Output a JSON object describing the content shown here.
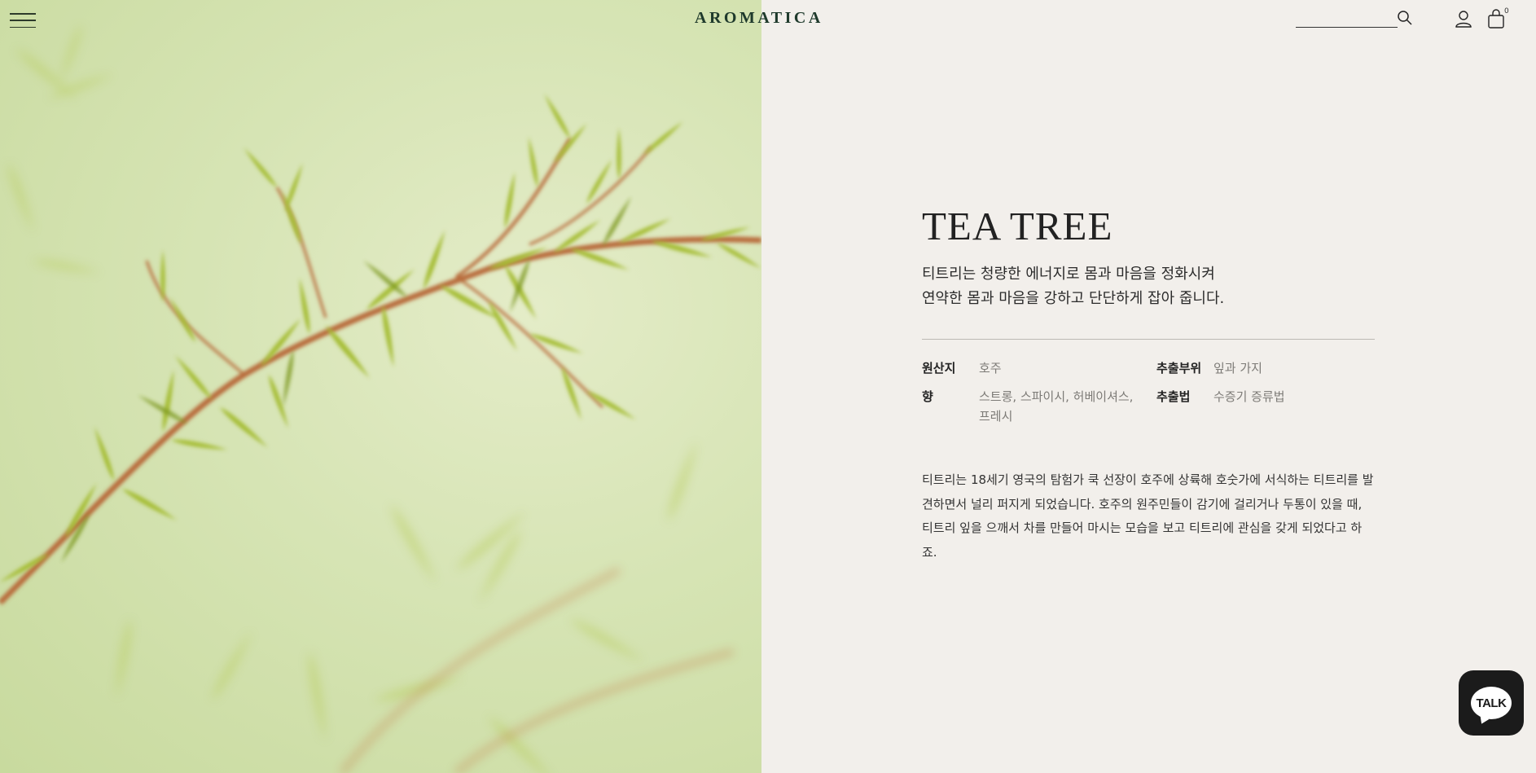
{
  "header": {
    "logo": "AROMATICA",
    "search": {
      "placeholder": "",
      "value": ""
    },
    "cart_count": "0",
    "icons": {
      "menu": "menu-icon",
      "search": "search-icon",
      "user": "user-icon",
      "cart": "shopping-bag-icon"
    }
  },
  "product": {
    "title": "TEA TREE",
    "subtitle_lines": [
      "티트리는 청량한 에너지로 몸과 마음을 정화시켜",
      "연약한 몸과 마음을 강하고 단단하게 잡아 줍니다."
    ],
    "specs": {
      "origin": {
        "label": "원산지",
        "value": "호주"
      },
      "part": {
        "label": "추출부위",
        "value": "잎과 가지"
      },
      "scent": {
        "label": "향",
        "value": "스트롱, 스파이시, 허베이셔스, 프레시"
      },
      "method": {
        "label": "추출법",
        "value": "수증기 증류법"
      }
    },
    "description": "티트리는 18세기 영국의 탐험가 쿡 선장이 호주에 상륙해 호숫가에 서식하는 티트리를 발견하면서 널리 퍼지게 되었습니다. 호주의 원주민들이 감기에 걸리거나 두통이 있을 때, 티트리 잎을 으깨서 차를 만들어 마시는 모습을 보고 티트리에 관심을 갖게 되었다고 하죠."
  },
  "talk_button": {
    "label": "TALK"
  },
  "colors": {
    "background": "#f2efeb",
    "logo": "#1f3a2c",
    "hero_bg": "#d6e4b4",
    "leaf": "#9fb832",
    "stem": "#b86a3a"
  }
}
